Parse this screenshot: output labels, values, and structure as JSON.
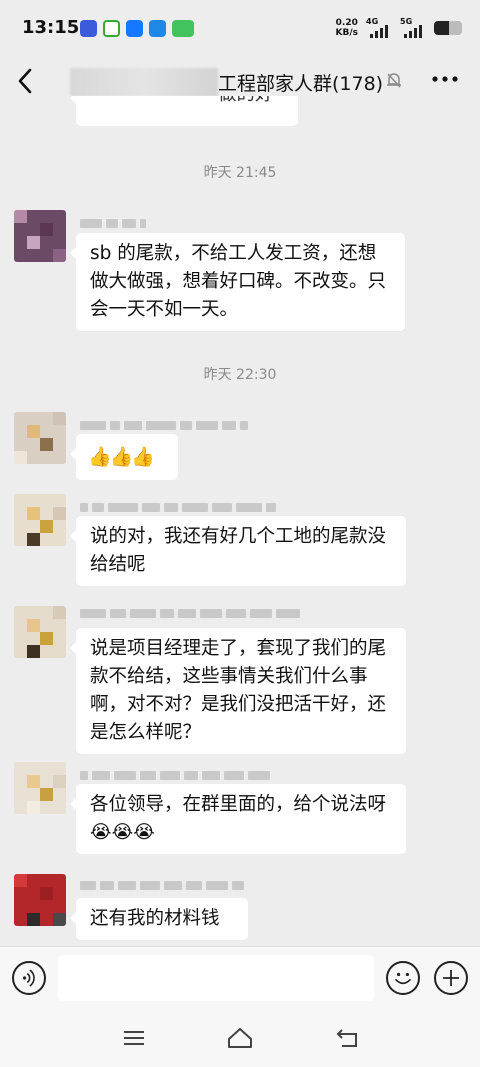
{
  "status_bar": {
    "time": "13:15",
    "speed_value": "0.20",
    "speed_unit": "KB/s",
    "net1": "4G",
    "net2": "5G"
  },
  "header": {
    "title": "工程部家人群(178)",
    "mute_icon": "bell-off-icon",
    "more_icon": "more-dots-icon"
  },
  "chat": {
    "top_partial_text": "做的好",
    "timestamps": [
      "昨天 21:45",
      "昨天 22:30"
    ],
    "messages": [
      {
        "text": "sb 的尾款，不给工人发工资，还想做大做强，想着好口碑。不改变。只会一天不如一天。"
      },
      {
        "text": "👍👍👍"
      },
      {
        "text": "说的对，我还有好几个工地的尾款没给结呢"
      },
      {
        "text": "说是项目经理走了，套现了我们的尾款不给结，这些事情关我们什么事啊，对不对？是我们没把活干好，还是怎么样呢？"
      },
      {
        "text": "各位领导，在群里面的，给个说法呀😭😭😭"
      },
      {
        "text": "还有我的材料钱"
      }
    ]
  },
  "input_bar": {
    "voice_icon": "voice-icon",
    "emoji_icon": "emoji-icon",
    "plus_icon": "plus-icon"
  },
  "nav_bar": {
    "menu_icon": "menu-icon",
    "home_icon": "home-icon",
    "back_icon": "back-icon"
  },
  "colors": {
    "background": "#ededed",
    "bubble": "#ffffff",
    "timestamp": "#8a8a8a"
  }
}
